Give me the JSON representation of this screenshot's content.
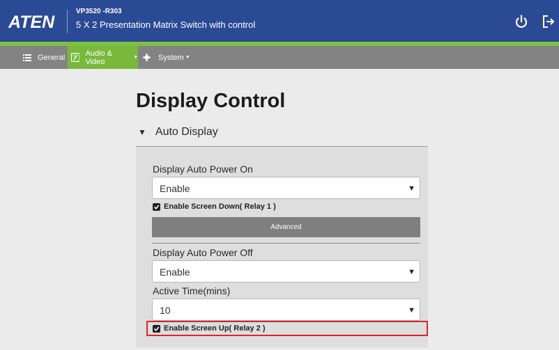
{
  "header": {
    "logo_text": "ATEN",
    "model": "VP3520 -R303",
    "product_name": "5 X 2 Presentation Matrix Switch with control",
    "icons": [
      "power-icon",
      "logout-icon"
    ]
  },
  "nav": {
    "items": [
      {
        "label": "General",
        "icon": "list-icon"
      },
      {
        "label": "Audio & Video",
        "icon": "av-icon",
        "active": true
      },
      {
        "label": "System",
        "icon": "gear-icon"
      }
    ]
  },
  "page": {
    "title": "Display Control",
    "section": "Auto Display"
  },
  "form": {
    "auto_power_on_label": "Display Auto Power On",
    "auto_power_on_value": "Enable",
    "screen_down_label": "Enable Screen Down( Relay 1 )",
    "advanced_label": "Advanced",
    "auto_power_off_label": "Display Auto Power Off",
    "auto_power_off_value": "Enable",
    "active_time_label": "Active Time(mins)",
    "active_time_value": "10",
    "screen_up_label": "Enable Screen Up( Relay 2 )"
  },
  "colors": {
    "header_bg": "#2b4a95",
    "accent_green": "#7cc242",
    "nav_bg": "#838383",
    "highlight": "#e0222b"
  }
}
